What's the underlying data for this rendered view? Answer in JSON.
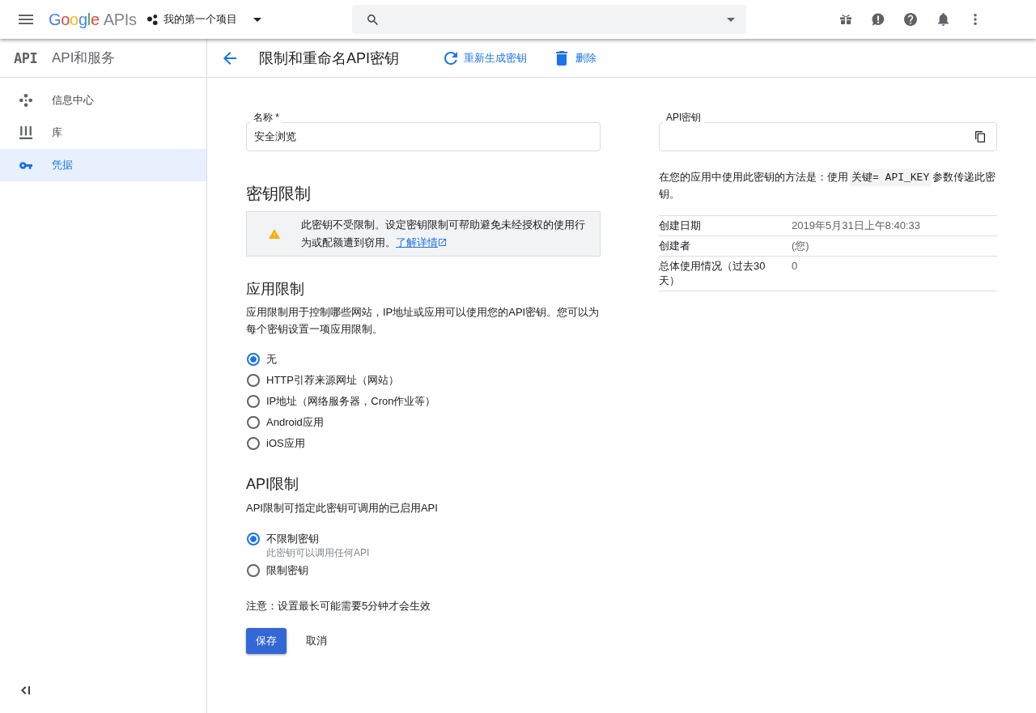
{
  "header": {
    "logo": {
      "brand": "Google",
      "product": "APIs"
    },
    "project": "我的第一个项目"
  },
  "sidebar": {
    "badge": "API",
    "title": "API和服务",
    "items": [
      {
        "label": "信息中心",
        "kind": "dashboard",
        "selected": false
      },
      {
        "label": "库",
        "kind": "library",
        "selected": false
      },
      {
        "label": "凭据",
        "kind": "credentials",
        "selected": true
      }
    ]
  },
  "page_header": {
    "title": "限制和重命名API密钥",
    "actions": [
      {
        "label": "重新生成密钥",
        "kind": "regenerate"
      },
      {
        "label": "删除",
        "kind": "delete"
      }
    ]
  },
  "form": {
    "name_field": {
      "label": "名称 *",
      "value": "安全浏览"
    },
    "key_restrictions": {
      "heading": "密钥限制",
      "warning": {
        "text": "此密钥不受限制。设定密钥限制可帮助避免未经授权的使用行为或配额遭到窃用。",
        "link": "了解详情"
      }
    },
    "application_restrictions": {
      "heading": "应用限制",
      "description": "应用限制用于控制哪些网站，IP地址或应用可以使用您的API密钥。您可以为每个密钥设置一项应用限制。",
      "options": [
        {
          "label": "无",
          "selected": true
        },
        {
          "label": "HTTP引荐来源网址（网站）",
          "selected": false
        },
        {
          "label": "IP地址（网络服务器，Cron作业等）",
          "selected": false
        },
        {
          "label": "Android应用",
          "selected": false
        },
        {
          "label": "iOS应用",
          "selected": false
        }
      ]
    },
    "api_restrictions": {
      "heading": "API限制",
      "description": "API限制可指定此密钥可调用的已启用API",
      "options": [
        {
          "label": "不限制密钥",
          "hint": "此密钥可以调用任何API",
          "selected": true
        },
        {
          "label": "限制密钥",
          "selected": false
        }
      ]
    },
    "note": "注意：设置最长可能需要5分钟才会生效",
    "buttons": [
      {
        "label": "保存",
        "kind": "primary"
      },
      {
        "label": "取消",
        "kind": "text"
      }
    ]
  },
  "key_panel": {
    "api_key_field": {
      "label": "API密钥"
    },
    "usage": {
      "before": "在您的应用中使用此密钥的方法是：使用",
      "code": "关键= API_KEY",
      "after": "参数传递此密钥。"
    },
    "details": [
      {
        "label": "创建日期",
        "value": "2019年5月31日上午8:40:33"
      },
      {
        "label": "创建者",
        "value": "(您)"
      },
      {
        "label": "总体使用情况（过去30天）",
        "value": "0"
      }
    ]
  }
}
